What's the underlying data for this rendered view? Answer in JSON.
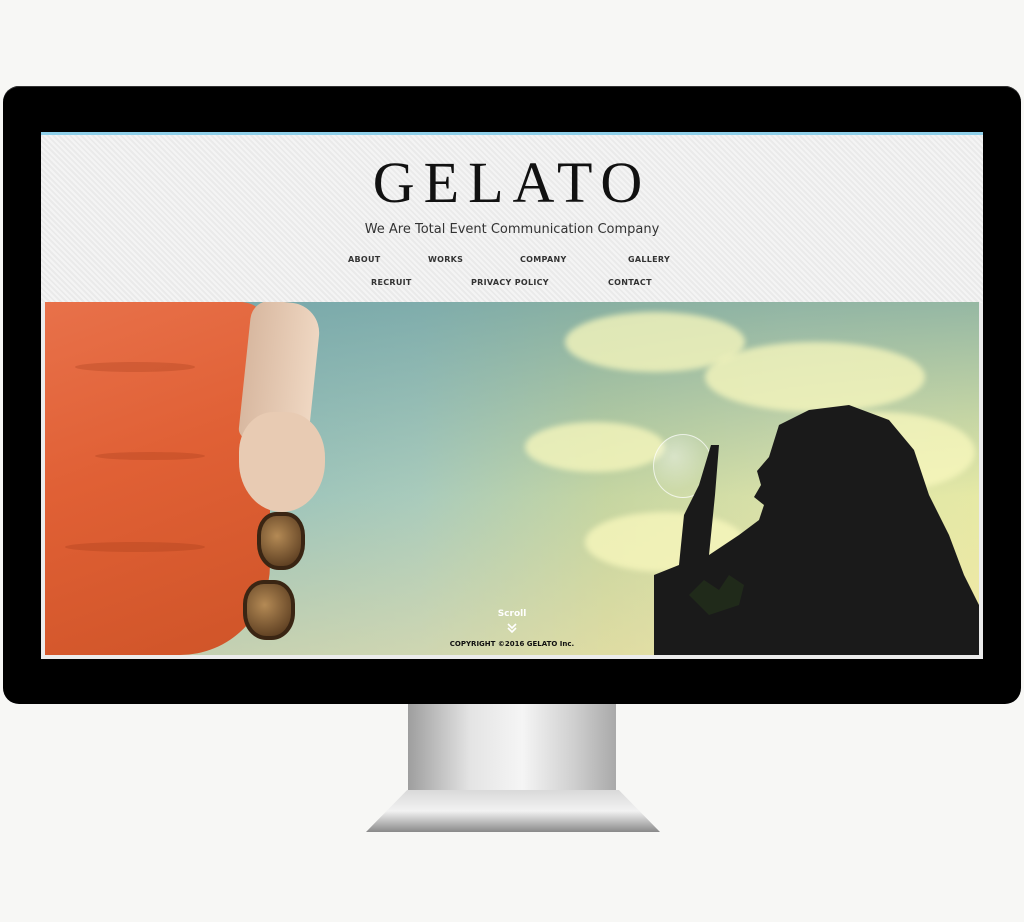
{
  "site": {
    "logo": "GELATO",
    "tagline": "We Are Total Event Communication Company"
  },
  "nav": {
    "row1": [
      "ABOUT",
      "WORKS",
      "COMPANY",
      "GALLERY"
    ],
    "row2": [
      "RECRUIT",
      "PRIVACY POLICY",
      "CONTACT"
    ]
  },
  "hero": {
    "scroll_label": "Scroll",
    "scroll_icon": "double-chevron-down-icon"
  },
  "footer": {
    "copyright": "COPYRIGHT ©2016 GELATO Inc."
  },
  "colors": {
    "accent_line": "#8fd0ea",
    "bezel": "#000000",
    "header_bg": "#eeeeee"
  }
}
